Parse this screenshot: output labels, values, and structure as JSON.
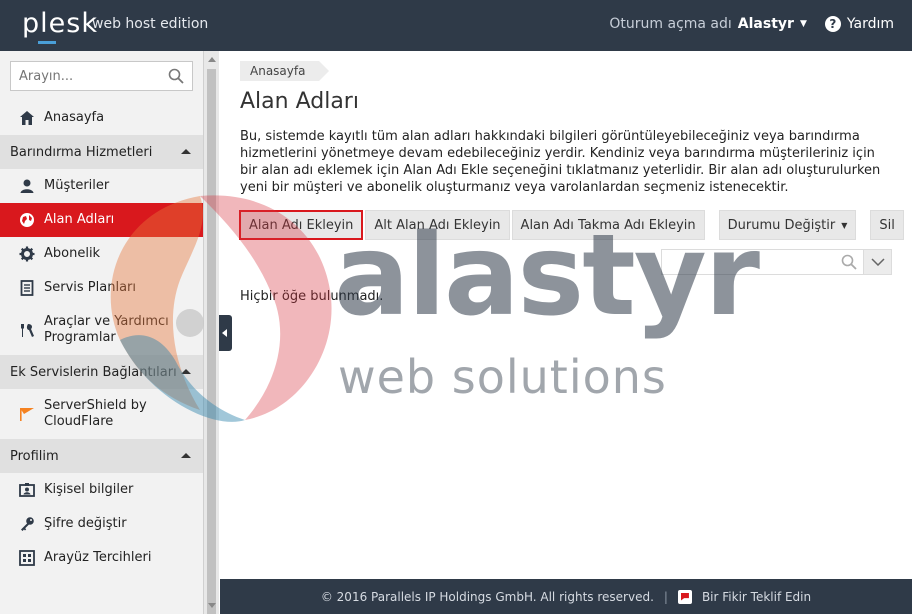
{
  "header": {
    "logo": "plesk",
    "edition": "web host edition",
    "login_label": "Oturum açma adı",
    "username": "Alastyr",
    "help_label": "Yardım"
  },
  "sidebar": {
    "search_placeholder": "Arayın...",
    "items": {
      "home": "Anasayfa",
      "section_hosting": "Barındırma Hizmetleri",
      "customers": "Müşteriler",
      "domains": "Alan Adları",
      "subscriptions": "Abonelik",
      "service_plans": "Servis Planları",
      "tools_1": "Araçlar ve Yardımcı",
      "tools_2": "Programlar",
      "section_extras": "Ek Servislerin Bağlantıları",
      "servershield_1": "ServerShield by",
      "servershield_2": "CloudFlare",
      "section_profile": "Profilim",
      "personal_info": "Kişisel bilgiler",
      "change_password": "Şifre değiştir",
      "interface_prefs": "Arayüz Tercihleri"
    }
  },
  "main": {
    "breadcrumb": "Anasayfa",
    "title": "Alan Adları",
    "description": "Bu, sistemde kayıtlı tüm alan adları hakkındaki bilgileri görüntüleyebileceğiniz veya barındırma hizmetlerini yönetmeye devam edebileceğiniz yerdir. Kendiniz veya barındırma müşterileriniz için bir alan adı eklemek için Alan Adı Ekle seçeneğini tıklatmanız yeterlidir. Bir alan adı oluşturulurken yeni bir müşteri ve abonelik oluşturmanız veya varolanlardan seçmeniz istenecektir.",
    "buttons": {
      "add_domain": "Alan Adı Ekleyin",
      "add_subdomain": "Alt Alan Adı Ekleyin",
      "add_alias": "Alan Adı Takma Adı Ekleyin",
      "change_status": "Durumu Değiştir",
      "delete": "Sil"
    },
    "empty_message": "Hiçbir öğe bulunmadı."
  },
  "footer": {
    "copyright": "© 2016 Parallels IP Holdings GmbH. All rights reserved.",
    "separator": "|",
    "feedback": "Bir Fikir Teklif Edin"
  },
  "watermark": {
    "big": "alastyr",
    "small": "web solutions"
  },
  "colors": {
    "header_bg": "#2f3a48",
    "accent_red": "#d9181d",
    "sidebar_bg": "#f2f2f2"
  }
}
